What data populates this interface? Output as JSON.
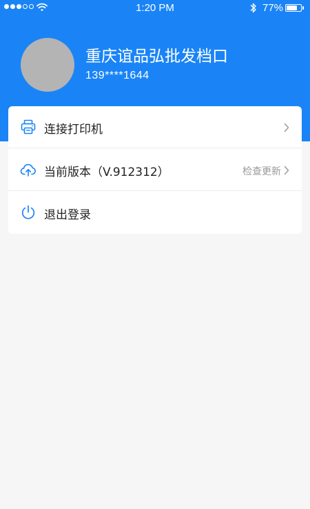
{
  "status_bar": {
    "time": "1:20 PM",
    "battery_percent_text": "77%",
    "battery_level": 0.77,
    "signal_bars_filled": 3,
    "signal_bars_total": 5,
    "icons": [
      "signal-icon",
      "wifi-icon",
      "bluetooth-icon",
      "battery-icon"
    ]
  },
  "profile": {
    "store_name": "重庆谊品弘批发档口",
    "phone": "139****1644"
  },
  "menu": {
    "items": [
      {
        "label": "连接打印机",
        "icon": "printer-icon",
        "right_text": "",
        "has_chevron": true
      },
      {
        "label": "当前版本（V.912312）",
        "icon": "cloud-upload-icon",
        "right_text": "检查更新",
        "has_chevron": true
      },
      {
        "label": "退出登录",
        "icon": "power-icon",
        "right_text": "",
        "has_chevron": false
      }
    ]
  },
  "colors": {
    "header_bg": "#1a84f6",
    "icon_blue": "#1a84f6",
    "page_bg": "#f6f6f6"
  }
}
